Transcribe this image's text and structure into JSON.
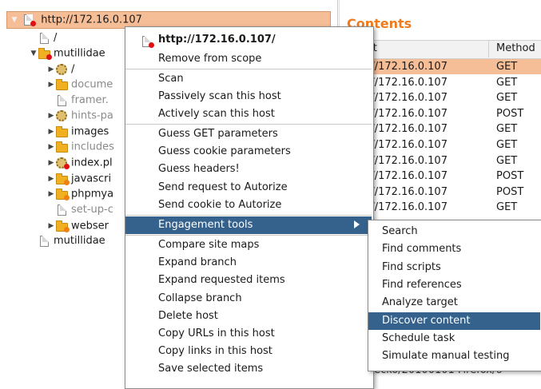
{
  "tree": {
    "root": "http://172.16.0.107",
    "items": [
      {
        "label": "/",
        "type": "page",
        "state": "none",
        "depth": 1,
        "muted": false
      },
      {
        "label": "mutillidae",
        "type": "folder",
        "state": "open",
        "depth": 1,
        "muted": false,
        "dot": "red"
      },
      {
        "label": "/",
        "type": "gear",
        "state": "closed",
        "depth": 2,
        "muted": false
      },
      {
        "label": "docume",
        "type": "folder",
        "state": "closed",
        "depth": 2,
        "muted": true
      },
      {
        "label": "framer.",
        "type": "page",
        "state": "none",
        "depth": 2,
        "muted": true
      },
      {
        "label": "hints-pa",
        "type": "gear",
        "state": "closed",
        "depth": 2,
        "muted": true
      },
      {
        "label": "images",
        "type": "folder",
        "state": "closed",
        "depth": 2,
        "muted": false
      },
      {
        "label": "includes",
        "type": "folder",
        "state": "closed",
        "depth": 2,
        "muted": true
      },
      {
        "label": "index.pl",
        "type": "gear",
        "state": "closed",
        "depth": 2,
        "muted": false,
        "dot": "red"
      },
      {
        "label": "javascri",
        "type": "folder",
        "state": "closed",
        "depth": 2,
        "muted": false,
        "dot": "orange"
      },
      {
        "label": "phpmya",
        "type": "folder",
        "state": "closed",
        "depth": 2,
        "muted": false,
        "dot": "orange"
      },
      {
        "label": "set-up-c",
        "type": "page",
        "state": "none",
        "depth": 2,
        "muted": true
      },
      {
        "label": "webser",
        "type": "folder",
        "state": "closed",
        "depth": 2,
        "muted": false,
        "dot": "orange"
      },
      {
        "label": "mutillidae",
        "type": "page",
        "state": "none",
        "depth": 1,
        "muted": false
      }
    ]
  },
  "contents": {
    "title": "Contents",
    "col_host": "st",
    "col_method": "Method",
    "rows": [
      {
        "host": "://172.16.0.107",
        "method": "GET"
      },
      {
        "host": "://172.16.0.107",
        "method": "GET"
      },
      {
        "host": "://172.16.0.107",
        "method": "GET"
      },
      {
        "host": "://172.16.0.107",
        "method": "POST"
      },
      {
        "host": "://172.16.0.107",
        "method": "GET"
      },
      {
        "host": "://172.16.0.107",
        "method": "GET"
      },
      {
        "host": "://172.16.0.107",
        "method": "GET"
      },
      {
        "host": "://172.16.0.107",
        "method": "POST"
      },
      {
        "host": "://172.16.0.107",
        "method": "POST"
      },
      {
        "host": "://172.16.0.107",
        "method": "GET"
      }
    ],
    "request_fragment": "Gecko/20100101 Firefox/6"
  },
  "context_menu": {
    "title": "http://172.16.0.107/",
    "items": [
      "Remove from scope",
      "Scan",
      "Passively scan this host",
      "Actively scan this host",
      "Guess GET parameters",
      "Guess cookie parameters",
      "Guess headers!",
      "Send request to Autorize",
      "Send cookie to Autorize",
      "Engagement tools",
      "Compare site maps",
      "Expand branch",
      "Expand requested items",
      "Collapse branch",
      "Delete host",
      "Copy URLs in this host",
      "Copy links in this host",
      "Save selected items"
    ],
    "highlighted": "Engagement tools"
  },
  "submenu": {
    "items": [
      "Search",
      "Find comments",
      "Find scripts",
      "Find references",
      "Analyze target",
      "Discover content",
      "Schedule task",
      "Simulate manual testing"
    ],
    "highlighted": "Discover content"
  },
  "colors": {
    "selection": "#f6be96",
    "menu_highlight": "#34628c",
    "title_accent": "#ef7b1f"
  }
}
